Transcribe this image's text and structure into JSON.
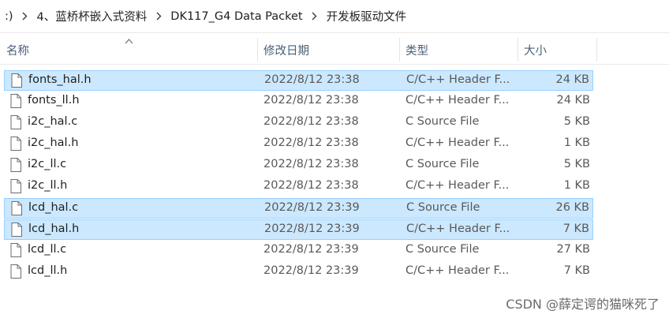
{
  "breadcrumb": {
    "items": [
      ":)",
      "4、蓝桥杯嵌入式资料",
      "DK117_G4 Data Packet",
      "开发板驱动文件"
    ]
  },
  "columns": {
    "name": "名称",
    "date": "修改日期",
    "type": "类型",
    "size": "大小"
  },
  "files": [
    {
      "name": "fonts_hal.h",
      "date": "2022/8/12 23:38",
      "type": "C/C++ Header F...",
      "size": "24 KB",
      "selected": true
    },
    {
      "name": "fonts_ll.h",
      "date": "2022/8/12 23:38",
      "type": "C/C++ Header F...",
      "size": "24 KB",
      "selected": false
    },
    {
      "name": "i2c_hal.c",
      "date": "2022/8/12 23:38",
      "type": "C Source File",
      "size": "5 KB",
      "selected": false
    },
    {
      "name": "i2c_hal.h",
      "date": "2022/8/12 23:38",
      "type": "C/C++ Header F...",
      "size": "1 KB",
      "selected": false
    },
    {
      "name": "i2c_ll.c",
      "date": "2022/8/12 23:38",
      "type": "C Source File",
      "size": "5 KB",
      "selected": false
    },
    {
      "name": "i2c_ll.h",
      "date": "2022/8/12 23:38",
      "type": "C/C++ Header F...",
      "size": "1 KB",
      "selected": false
    },
    {
      "name": "lcd_hal.c",
      "date": "2022/8/12 23:39",
      "type": "C Source File",
      "size": "26 KB",
      "selected": true
    },
    {
      "name": "lcd_hal.h",
      "date": "2022/8/12 23:39",
      "type": "C/C++ Header F...",
      "size": "7 KB",
      "selected": true
    },
    {
      "name": "lcd_ll.c",
      "date": "2022/8/12 23:39",
      "type": "C Source File",
      "size": "27 KB",
      "selected": false
    },
    {
      "name": "lcd_ll.h",
      "date": "2022/8/12 23:39",
      "type": "C/C++ Header F...",
      "size": "7 KB",
      "selected": false
    }
  ],
  "watermark": "CSDN @薛定谔的猫咪死了",
  "colors": {
    "selection_bg": "#cce8ff",
    "selection_border": "#99d1ff",
    "header_text": "#4c607a"
  },
  "icons": {
    "file": "document-icon",
    "separator": "chevron-right-icon",
    "sort": "sort-up-icon"
  }
}
